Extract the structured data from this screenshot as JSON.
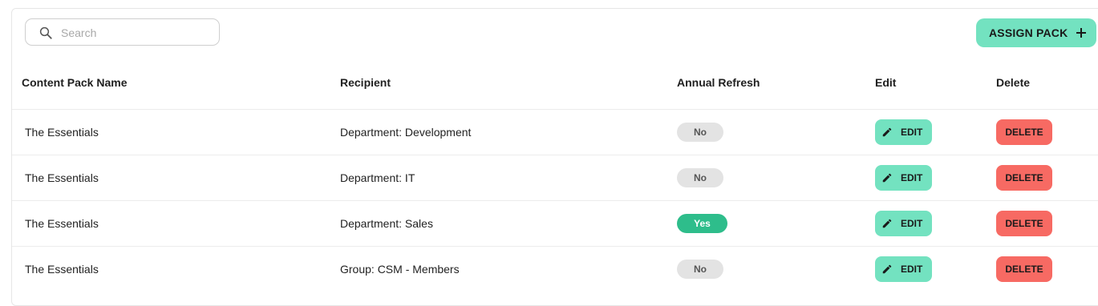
{
  "search": {
    "placeholder": "Search",
    "value": ""
  },
  "assign_button": {
    "label": "ASSIGN PACK",
    "icon": "plus-icon"
  },
  "columns": {
    "name": "Content Pack Name",
    "recipient": "Recipient",
    "annual_refresh": "Annual Refresh",
    "edit": "Edit",
    "delete": "Delete"
  },
  "rows": [
    {
      "name": "The Essentials",
      "recipient": "Department: Development",
      "refresh": "No",
      "refresh_on": false,
      "edit_label": "EDIT",
      "delete_label": "DELETE"
    },
    {
      "name": "The Essentials",
      "recipient": "Department: IT",
      "refresh": "No",
      "refresh_on": false,
      "edit_label": "EDIT",
      "delete_label": "DELETE"
    },
    {
      "name": "The Essentials",
      "recipient": "Department: Sales",
      "refresh": "Yes",
      "refresh_on": true,
      "edit_label": "EDIT",
      "delete_label": "DELETE"
    },
    {
      "name": "The Essentials",
      "recipient": "Group: CSM - Members",
      "refresh": "No",
      "refresh_on": false,
      "edit_label": "EDIT",
      "delete_label": "DELETE"
    }
  ],
  "colors": {
    "accent": "#73e2c0",
    "danger": "#f76a63",
    "yes_pill": "#2ebd8b",
    "no_pill": "#e3e3e3"
  }
}
